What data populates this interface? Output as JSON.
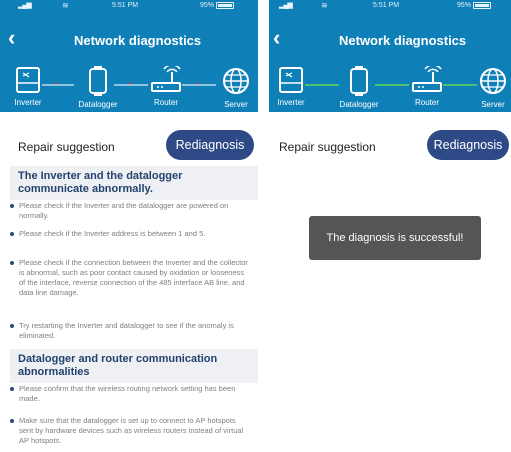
{
  "status_bar": {
    "time": "5:51 PM",
    "battery": "95%"
  },
  "nav": {
    "back_symbol": "‹",
    "title": "Network diagnostics"
  },
  "devices": [
    {
      "label": "Inverter",
      "icon": "inverter-icon"
    },
    {
      "label": "Datalogger",
      "icon": "datalogger-icon"
    },
    {
      "label": "Router",
      "icon": "router-icon"
    },
    {
      "label": "Server",
      "icon": "globe-icon"
    }
  ],
  "colors": {
    "header": "#0f7fb8",
    "button": "#2e4a86",
    "link_error": "#e8323c",
    "link_ok": "#4cc36b",
    "section_bg": "#eef0f3",
    "toast_bg": "#555555"
  },
  "left_screen": {
    "link_states": [
      "error",
      "error",
      "error"
    ],
    "repair_label": "Repair suggestion",
    "rediagnosis_label": "Rediagnosis",
    "sections": [
      {
        "title": "The Inverter and the datalogger communicate abnormally.",
        "tips": [
          "Please check if the Inverter and the datalogger are powered on normally.",
          "Please check if the Inverter address is between 1 and 5.",
          "Please check if the connection between the Inverter and the collector is abnormal, such as poor contact caused by oxidation or looseness of the interface, reverse connection of the 485 interface AB line, and data line damage.",
          "Try restarting the Inverter and datalogger to see if the anomaly is eliminated."
        ]
      },
      {
        "title": "Datalogger and router communication abnormalities",
        "tips": [
          "Please confirm that the wireless routing network setting has been made.",
          "Make sure that the datalogger is set up to connect to AP hotspots sent by hardware devices such as wireless routers instead of virtual AP hotspots."
        ]
      }
    ]
  },
  "right_screen": {
    "link_states": [
      "ok",
      "ok",
      "ok"
    ],
    "repair_label": "Repair suggestion",
    "rediagnosis_label": "Rediagnosis",
    "toast": "The diagnosis is successful!"
  }
}
